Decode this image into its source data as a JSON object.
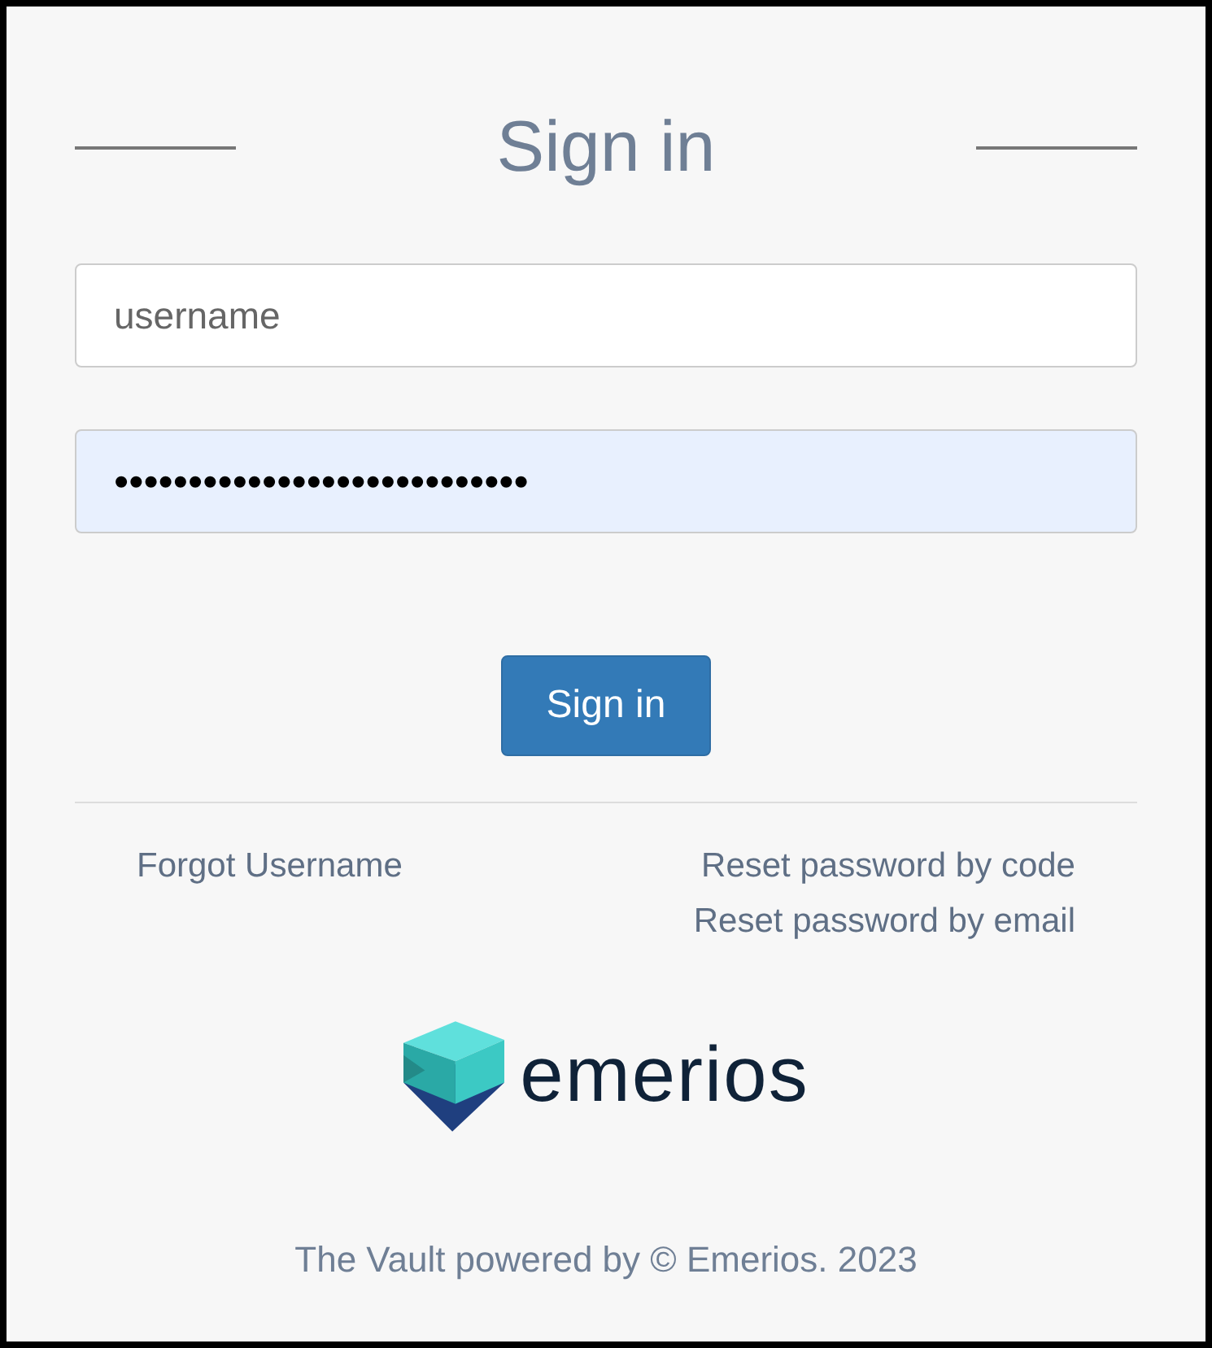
{
  "title": "Sign in",
  "username_field": {
    "placeholder": "username"
  },
  "password_field": {
    "value": "••••••••••••••••••••••••••••",
    "autofilled": true
  },
  "sign_in_button": "Sign in",
  "links_left": [
    "Forgot Username"
  ],
  "links_right": [
    "Reset password by code",
    "Reset password by email"
  ],
  "logo_text": "emerios",
  "footer": "The Vault powered by © Emerios. 2023"
}
